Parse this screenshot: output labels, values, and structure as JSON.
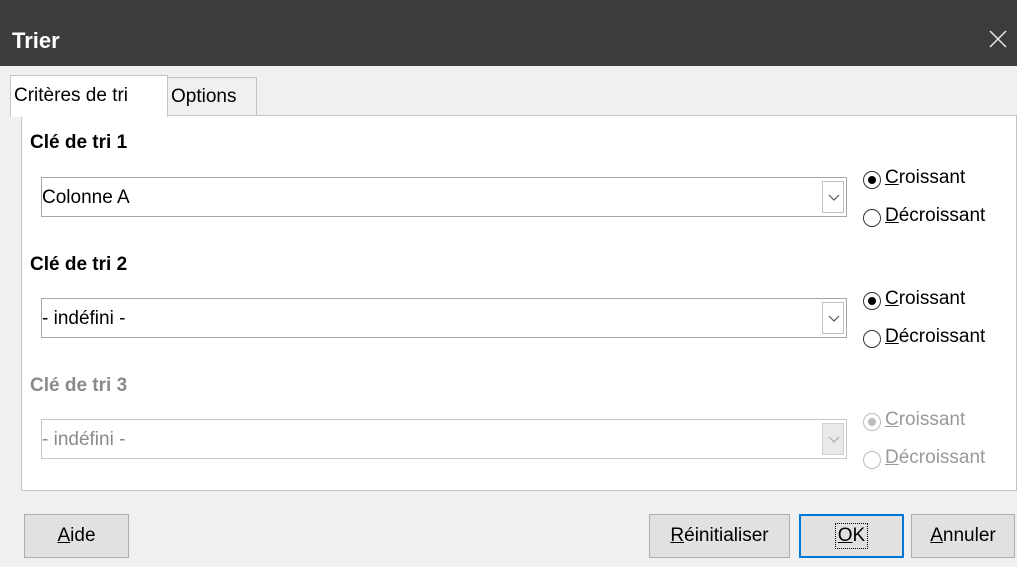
{
  "window": {
    "title": "Trier"
  },
  "tabs": [
    {
      "label": "Critères de tri",
      "active": true
    },
    {
      "label": "Options",
      "active": false
    }
  ],
  "sort_keys": [
    {
      "title": "Clé de tri 1",
      "value": "Colonne A",
      "enabled": true,
      "order": "ascending",
      "ascending_label_accel": "C",
      "ascending_label_rest": "roissant",
      "descending_label_accel": "D",
      "descending_label_rest": "écroissant"
    },
    {
      "title": "Clé de tri 2",
      "value": "- indéfini -",
      "enabled": true,
      "order": "ascending",
      "ascending_label_accel": "C",
      "ascending_label_rest": "roissant",
      "descending_label_accel": "D",
      "descending_label_rest": "écroissant"
    },
    {
      "title": "Clé de tri 3",
      "value": "- indéfini -",
      "enabled": false,
      "order": "ascending",
      "ascending_label_accel": "C",
      "ascending_label_rest": "roissant",
      "descending_label_accel": "D",
      "descending_label_rest": "écroissant"
    }
  ],
  "buttons": {
    "help": {
      "accel": "A",
      "rest": "ide"
    },
    "reset": {
      "accel": "R",
      "rest": "éinitialiser"
    },
    "ok": {
      "accel": "O",
      "rest": "K"
    },
    "cancel": {
      "accel": "A",
      "rest": "nnuler"
    }
  },
  "colors": {
    "titlebar": "#3c3c3c",
    "focus_border": "#0078d7",
    "disabled_text": "#8a8a8a"
  }
}
